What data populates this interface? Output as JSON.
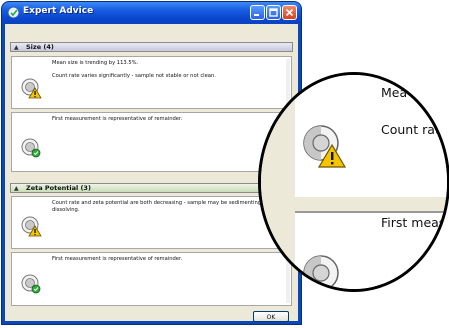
{
  "window": {
    "title": "Expert Advice"
  },
  "groups": [
    {
      "header": "Size (4)",
      "items": [
        {
          "lines": [
            "Mean size is trending by 113.5%.",
            "Count rate varies significantly - sample not stable or not clean."
          ],
          "icon": "warning"
        },
        {
          "lines": [
            "First measurement is representative of remainder."
          ],
          "icon": "ok"
        }
      ]
    },
    {
      "header": "Zeta Potential (3)",
      "items": [
        {
          "lines": [
            "Count rate and zeta potential are both decreasing - sample may be sedimenting or dissolving."
          ],
          "icon": "warning"
        },
        {
          "lines": [
            "First measurement is representative of remainder."
          ],
          "icon": "ok"
        }
      ]
    }
  ],
  "buttons": {
    "ok": "OK"
  },
  "magnifier": {
    "line_top": "Mea",
    "line_middle": "Count rat",
    "line_bottom": "First meas"
  },
  "colors": {
    "titlebar": "#0a48d1",
    "client": "#ece9d8",
    "size_header": "#c7c7de",
    "zeta_header": "#c9dcb7",
    "warning": "#f5c400",
    "ok": "#2fa83a"
  }
}
